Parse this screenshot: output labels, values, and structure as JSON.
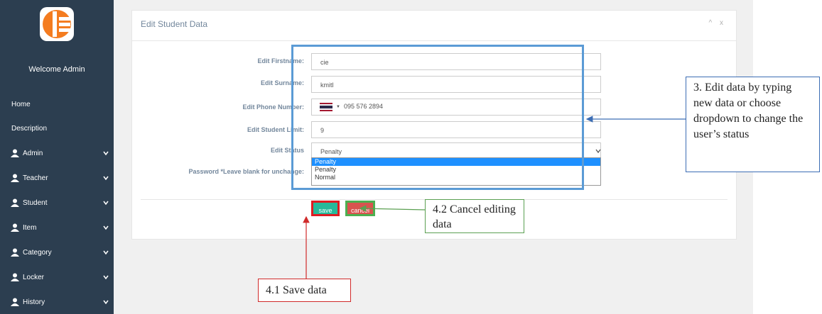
{
  "sidebar": {
    "welcome": "Welcome Admin",
    "items": [
      {
        "label": "Home",
        "icon": null,
        "expandable": false
      },
      {
        "label": "Description",
        "icon": null,
        "expandable": false
      },
      {
        "label": "Admin",
        "icon": "user-icon",
        "expandable": true
      },
      {
        "label": "Teacher",
        "icon": "user-icon",
        "expandable": true
      },
      {
        "label": "Student",
        "icon": "user-icon",
        "expandable": true
      },
      {
        "label": "Item",
        "icon": "user-icon",
        "expandable": true
      },
      {
        "label": "Category",
        "icon": "user-icon",
        "expandable": true
      },
      {
        "label": "Locker",
        "icon": "user-icon",
        "expandable": true
      },
      {
        "label": "History",
        "icon": "user-icon",
        "expandable": true
      }
    ]
  },
  "panel": {
    "title": "Edit Student Data",
    "tools": "^ x"
  },
  "form": {
    "firstname": {
      "label": "Edit Firstname:",
      "value": "cie"
    },
    "surname": {
      "label": "Edit Surname:",
      "value": "kmitl"
    },
    "phone": {
      "label": "Edit Phone Number:",
      "value": "095 576 2894",
      "flag_icon": "thailand-flag-icon"
    },
    "limit": {
      "label": "Edit Student Limit:",
      "value": "9"
    },
    "status": {
      "label": "Edit Status",
      "value": "Penalty",
      "options": [
        "Penalty",
        "Penalty",
        "Normal"
      ],
      "highlighted_option": 0
    },
    "password": {
      "label": "Password *Leave blank for unchange:"
    }
  },
  "buttons": {
    "save": "save",
    "cancel": "cancel"
  },
  "annotations": {
    "step3": "3. Edit data by typing new data or choose dropdown to change the user’s status",
    "step41": "4.1 Save data",
    "step42": "4.2 Cancel editing data"
  },
  "colors": {
    "sidebar": "#2c3e50",
    "save": "#26b99a",
    "cancel": "#d9534f",
    "highlight": "#5b9bd5",
    "step41_border": "#d02a2a",
    "step42_border": "#5ba052"
  }
}
